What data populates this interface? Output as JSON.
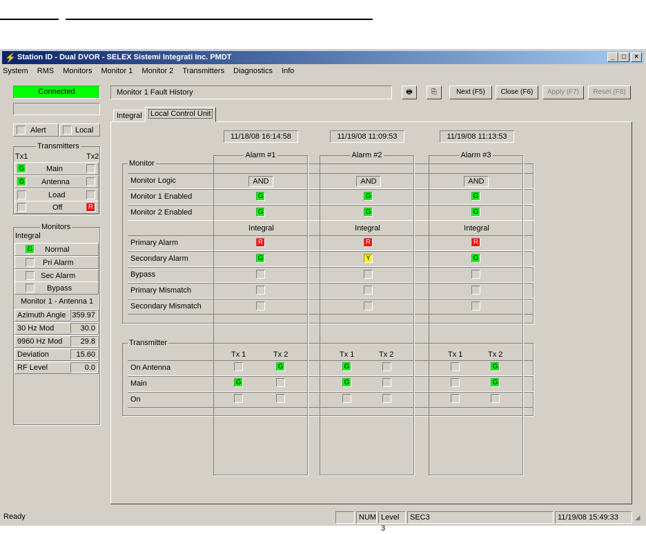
{
  "window": {
    "title": "Station ID - Dual DVOR - SELEX Sistemi Integrati Inc. PMDT",
    "controls": [
      "_",
      "□",
      "×"
    ]
  },
  "menu": [
    "System",
    "RMS",
    "Monitors",
    "Monitor 1",
    "Monitor 2",
    "Transmitters",
    "Diagnostics",
    "Info"
  ],
  "sidebar": {
    "status": "Connected",
    "alert_label": "Alert",
    "local_label": "Local",
    "transmitters": {
      "caption": "Transmitters",
      "tx1": "Tx1",
      "tx2": "Tx2",
      "rows": [
        {
          "label": "Main",
          "tx1": "G",
          "tx2": ""
        },
        {
          "label": "Antenna",
          "tx1": "G",
          "tx2": ""
        },
        {
          "label": "Load",
          "tx1": "",
          "tx2": ""
        },
        {
          "label": "Off",
          "tx1": "",
          "tx2": "R"
        }
      ]
    },
    "monitors": {
      "caption": "Monitors",
      "integral_label": "Integral",
      "rows": [
        {
          "label": "Normal",
          "state": "G"
        },
        {
          "label": "Pri Alarm",
          "state": ""
        },
        {
          "label": "Sec Alarm",
          "state": ""
        },
        {
          "label": "Bypass",
          "state": ""
        }
      ],
      "section_title": "Monitor 1 - Antenna 1",
      "params": [
        {
          "label": "Azimuth Angle",
          "value": "359.97"
        },
        {
          "label": "30 Hz Mod",
          "value": "30.0"
        },
        {
          "label": "9960 Hz Mod",
          "value": "29.8"
        },
        {
          "label": "Deviation",
          "value": "15.60"
        },
        {
          "label": "RF Level",
          "value": "0.0"
        }
      ]
    }
  },
  "header": {
    "title": "Monitor 1 Fault History",
    "print_icon": "printer-icon",
    "copy_icon": "copy-icon",
    "buttons": {
      "next": "Next (F5)",
      "close": "Close (F6)",
      "apply": "Apply (F7)",
      "reset": "Reset (F8)"
    }
  },
  "tabs": [
    "Integral",
    "Local Control Unit"
  ],
  "alarms": [
    {
      "name": "Alarm #1",
      "date": "11/18/08 16:14:58",
      "logic": "AND",
      "mon1": "G",
      "mon2": "G",
      "integral": "Integral",
      "primary": "R",
      "secondary": "G",
      "bypass": "",
      "pmis": "",
      "smis": "",
      "on_antenna": [
        "",
        "G"
      ],
      "main": [
        "G",
        ""
      ],
      "on": [
        "",
        ""
      ]
    },
    {
      "name": "Alarm #2",
      "date": "11/19/08 11:09:53",
      "logic": "AND",
      "mon1": "G",
      "mon2": "G",
      "integral": "Integral",
      "primary": "R",
      "secondary": "Y",
      "bypass": "",
      "pmis": "",
      "smis": "",
      "on_antenna": [
        "G",
        ""
      ],
      "main": [
        "G",
        ""
      ],
      "on": [
        "",
        ""
      ]
    },
    {
      "name": "Alarm #3",
      "date": "11/19/08 11:13:53",
      "logic": "AND",
      "mon1": "G",
      "mon2": "G",
      "integral": "Integral",
      "primary": "R",
      "secondary": "G",
      "bypass": "",
      "pmis": "",
      "smis": "",
      "on_antenna": [
        "",
        "G"
      ],
      "main": [
        "",
        "G"
      ],
      "on": [
        "",
        ""
      ]
    }
  ],
  "monitor_group": {
    "caption": "Monitor",
    "rows": [
      "Monitor Logic",
      "Monitor 1 Enabled",
      "Monitor 2 Enabled",
      "Primary Alarm",
      "Secondary Alarm",
      "Bypass",
      "Primary Mismatch",
      "Secondary Mismatch"
    ]
  },
  "transmitter_group": {
    "caption": "Transmitter",
    "tx1": "Tx 1",
    "tx2": "Tx 2",
    "rows": [
      "On Antenna",
      "Main",
      "On"
    ]
  },
  "statusbar": {
    "ready": "Ready",
    "num": "NUM",
    "level": "Level 3",
    "sec": "SEC3",
    "datetime": "11/19/08 15:49:33"
  },
  "colors": {
    "green": "#00ff00",
    "red": "#ff0000",
    "yellow": "#ffff00",
    "title_blue": "#0a246a"
  }
}
